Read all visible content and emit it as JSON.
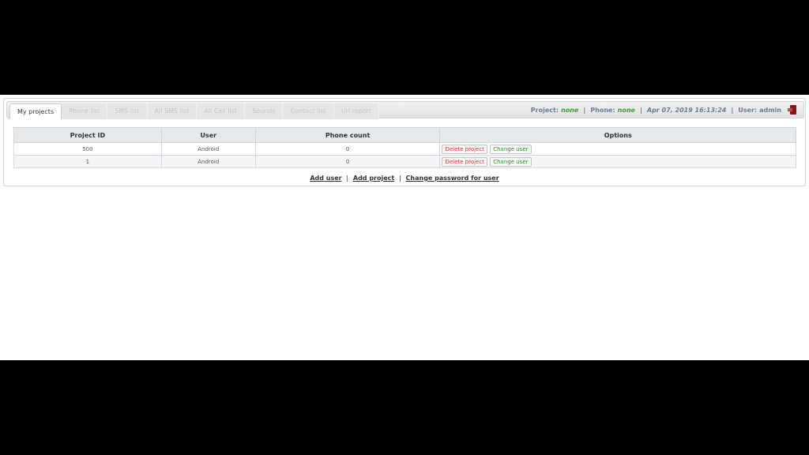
{
  "tabs": [
    {
      "label": "My projects",
      "active": true
    },
    {
      "label": "Phone list",
      "active": false
    },
    {
      "label": "SMS list",
      "active": false
    },
    {
      "label": "All SMS list",
      "active": false
    },
    {
      "label": "All Call list",
      "active": false
    },
    {
      "label": "Sounds",
      "active": false
    },
    {
      "label": "Contact list",
      "active": false
    },
    {
      "label": "Url report",
      "active": false
    }
  ],
  "status": {
    "project_label": "Project:",
    "project_value": "none",
    "phone_label": "Phone:",
    "phone_value": "none",
    "datetime": "Apr 07, 2019 16:13:24",
    "user_label": "User:",
    "user_value": "admin",
    "separator": "|",
    "exit_icon": "exit-icon"
  },
  "table": {
    "headers": [
      "Project ID",
      "User",
      "Phone count",
      "Options"
    ],
    "rows": [
      {
        "project_id": "500",
        "user": "Android",
        "phone_count": "0"
      },
      {
        "project_id": "1",
        "user": "Android",
        "phone_count": "0"
      }
    ],
    "delete_label": "Delete project",
    "change_label": "Change user"
  },
  "links": {
    "add_user": "Add user",
    "add_project": "Add project",
    "change_password": "Change password for user",
    "separator": "|"
  },
  "colors": {
    "status_label": "#6a7a9c",
    "status_value": "#38a036",
    "delete": "#d9323b",
    "change": "#3b8a33",
    "header_bg": "#e5e9ea"
  }
}
